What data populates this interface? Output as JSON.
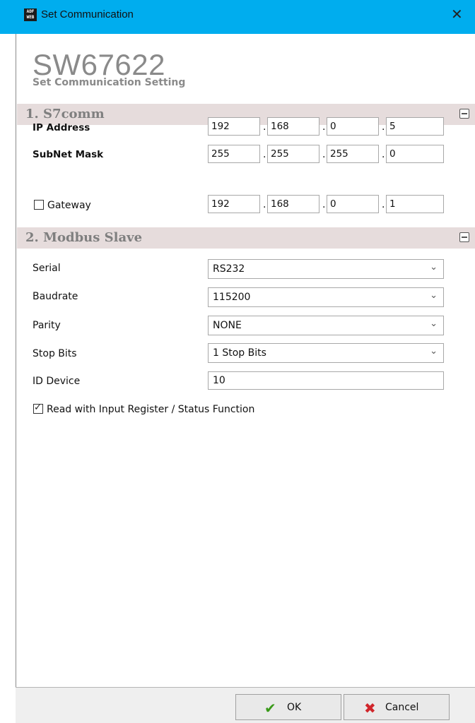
{
  "window": {
    "title": "Set Communication",
    "app_icon_text": "ADF\nWEB",
    "close": "✕"
  },
  "header": {
    "model": "SW67622",
    "subtitle": "Set Communication Setting"
  },
  "sections": {
    "s7comm": {
      "title": "1. S7comm",
      "ip_label": "IP Address",
      "ip": [
        "192",
        "168",
        "0",
        "5"
      ],
      "subnet_label": "SubNet Mask",
      "subnet": [
        "255",
        "255",
        "255",
        "0"
      ],
      "gateway_label": "Gateway",
      "gateway_checked": false,
      "gateway": [
        "192",
        "168",
        "0",
        "1"
      ]
    },
    "modbus": {
      "title": "2. Modbus Slave",
      "serial_label": "Serial",
      "serial_value": "RS232",
      "baud_label": "Baudrate",
      "baud_value": "115200",
      "parity_label": "Parity",
      "parity_value": "NONE",
      "stopbits_label": "Stop Bits",
      "stopbits_value": "1 Stop Bits",
      "id_label": "ID Device",
      "id_value": "10",
      "read_input_label": "Read with Input Register / Status Function",
      "read_input_checked": true
    }
  },
  "buttons": {
    "ok": "OK",
    "cancel": "Cancel"
  },
  "colors": {
    "titlebar": "#00adee",
    "section_bg": "#e6dcdc",
    "ok_icon": "#3a9a1a",
    "cancel_icon": "#d0262b"
  }
}
